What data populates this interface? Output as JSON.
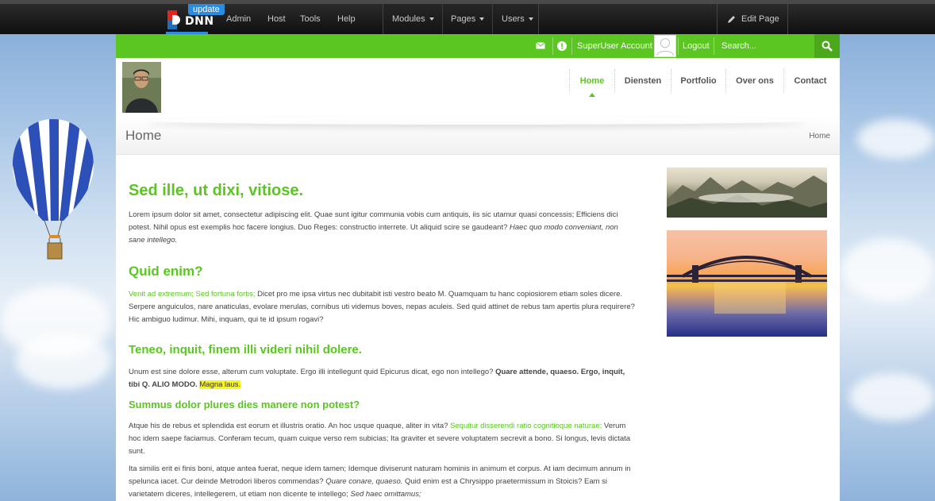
{
  "control_bar": {
    "logo_text": "DNN",
    "update_badge": "update",
    "menu": [
      "Admin",
      "Host",
      "Tools",
      "Help"
    ],
    "dropdowns": [
      "Modules",
      "Pages",
      "Users"
    ],
    "edit_page": "Edit Page"
  },
  "user_bar": {
    "user_name": "SuperUser Account",
    "logout": "Logout",
    "search_placeholder": "Search..."
  },
  "nav": {
    "items": [
      "Home",
      "Diensten",
      "Portfolio",
      "Over ons",
      "Contact"
    ],
    "active": "Home"
  },
  "title_band": {
    "title": "Home",
    "breadcrumb": "Home"
  },
  "content": {
    "h1": "Sed ille, ut dixi, vitiose.",
    "p1_text": "Lorem ipsum dolor sit amet, consectetur adipiscing elit. Quae sunt igitur communia vobis cum antiquis, iis sic utamur quasi concessis; Efficiens dici potest. Nihil opus est exemplis hoc facere longius. Duo Reges: constructio interrete. Ut aliquid scire se gaudeant? ",
    "p1_italic": "Haec quo modo conveniant, non sane intellego.",
    "h2": "Quid enim?",
    "p2_link": "Venit ad extremum; Sed fortuna fortis;",
    "p2_text": " Dicet pro me ipsa virtus nec dubitabit isti vestro beato M. Quamquam tu hanc copiosiorem etiam soles dicere. Serpere anguiculos, nare anaticulas, evolare merulas, cornibus uti videmus boves, nepas aculeis. Sed quid attinet de rebus tam apertis plura requirere? Hic ambiguo ludimur. Mihi, inquam, qui te id ipsum rogavi?",
    "h3": "Teneo, inquit, finem illi videri nihil dolere.",
    "p3_text": "Unum est sine dolore esse, alterum cum voluptate. Ergo illi intellegunt quid Epicurus dicat, ego non intellego? ",
    "p3_bold": "Quare attende, quaeso. Ergo, inquit, tibi Q. ALIO MODO.",
    "p3_highlight": "Magna laus.",
    "h4": "Summus dolor plures dies manere non potest?",
    "p4_text": "Atque his de rebus et splendida est eorum et illustris oratio. An hoc usque quaque, aliter in vita? ",
    "p4_link": "Sequitur disserendi ratio cognitioque naturae;",
    "p4_text2": " Verum hoc idem saepe faciamus. Conferam tecum, quam cuique verso rem subicias; Ita graviter et severe voluptatem secrevit a bono. Si longus, levis dictata sunt.",
    "p5_text": "Ita similis erit ei finis boni, atque antea fuerat, neque idem tamen; Idemque diviserunt naturam hominis in animum et corpus. At iam decimum annum in spelunca iacet. Cur deinde Metrodori liberos commendas? ",
    "p5_italic": "Quare conare, quaeso.",
    "p5_text2": " Quid enim est a Chrysippo praetermissum in Stoicis? Eam si varietatem diceres, intellegerem, ut etiam non dicente te intellego; ",
    "p5_italic2": "Sed haec omittamus;"
  },
  "colors": {
    "brand_green": "#5bc622",
    "control_bar": "#141414",
    "dnn_blue": "#2a8be0"
  }
}
